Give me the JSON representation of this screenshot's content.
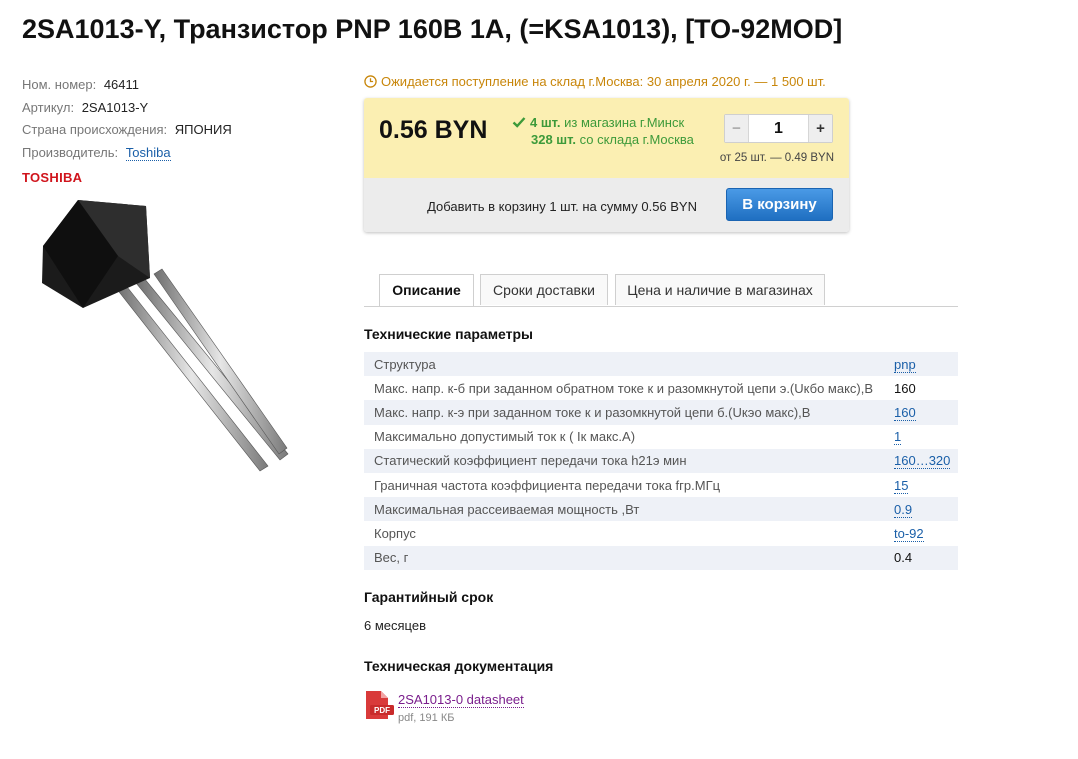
{
  "page_title": "2SA1013-Y, Транзистор PNP 160В 1А, (=KSA1013), [TO-92MOD]",
  "props": {
    "nom_label": "Ном. номер:",
    "nom_value": "46411",
    "article_label": "Артикул:",
    "article_value": "2SA1013-Y",
    "country_label": "Страна происхождения:",
    "country_value": "ЯПОНИЯ",
    "maker_label": "Производитель:",
    "maker_value": "Toshiba"
  },
  "brand_logo": "TOSHIBA",
  "notice": "Ожидается поступление на склад г.Москва: 30 апреля 2020 г. — 1 500 шт.",
  "buybox": {
    "price": "0.56 BYN",
    "stock1_qty": "4 шт.",
    "stock1_text": "из магазина г.Минск",
    "stock2_qty": "328 шт.",
    "stock2_text": "со склада г.Москва",
    "qty_minus": "−",
    "qty_value": "1",
    "qty_plus": "+",
    "bulk": "от 25 шт. — 0.49 BYN",
    "add_summary": "Добавить в корзину 1 шт. на сумму 0.56 BYN",
    "cart_button": "В корзину"
  },
  "tabs": [
    {
      "label": "Описание",
      "active": true
    },
    {
      "label": "Сроки доставки",
      "active": false
    },
    {
      "label": "Цена и наличие в магазинах",
      "active": false
    }
  ],
  "specs_heading": "Технические параметры",
  "specs": [
    {
      "name": "Структура",
      "value": "pnp",
      "link": true
    },
    {
      "name": "Макс. напр. к-б при заданном обратном токе к и разомкнутой цепи э.(Uкбо макс),В",
      "value": "160",
      "link": false
    },
    {
      "name": "Макс. напр. к-э при заданном токе к и разомкнутой цепи б.(Uкэо макс),В",
      "value": "160",
      "link": true
    },
    {
      "name": "Максимально допустимый ток к ( Iк макс.А)",
      "value": "1",
      "link": true
    },
    {
      "name": "Статический коэффициент передачи тока h21э мин",
      "value": "160…320",
      "link": true
    },
    {
      "name": "Граничная частота коэффициента передачи тока fгр.МГц",
      "value": "15",
      "link": true
    },
    {
      "name": "Максимальная рассеиваемая мощность ,Вт",
      "value": "0.9",
      "link": true
    },
    {
      "name": "Корпус",
      "value": "to-92",
      "link": true
    },
    {
      "name": "Вес, г",
      "value": "0.4",
      "link": false
    }
  ],
  "warranty_heading": "Гарантийный срок",
  "warranty_value": "6 месяцев",
  "docs_heading": "Техническая документация",
  "doc": {
    "icon_label": "PDF",
    "link": "2SA1013-0 datasheet",
    "meta": "pdf, 191 КБ"
  },
  "colors": {
    "accent": "#1a5fa8",
    "price_bg": "#fbefb2",
    "stock_green": "#3d9a3a",
    "notice": "#c8860a",
    "brand": "#d0141c"
  }
}
